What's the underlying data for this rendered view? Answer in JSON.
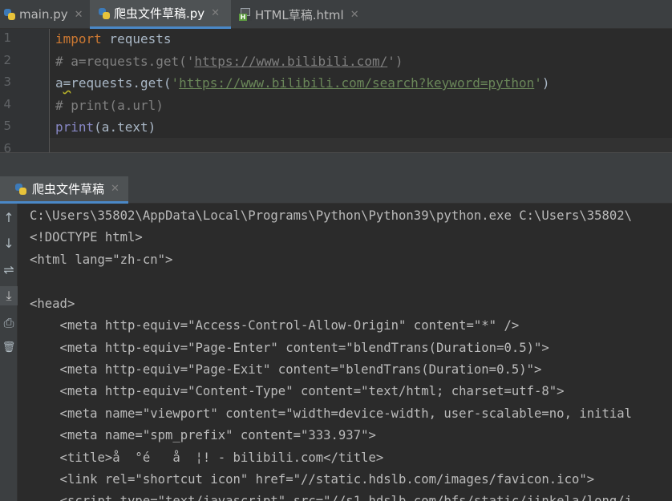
{
  "editor_tabs": [
    {
      "label": "main.py",
      "icon": "python-file-icon",
      "active": false
    },
    {
      "label": "爬虫文件草稿.py",
      "icon": "python-file-icon",
      "active": true
    },
    {
      "label": "HTML草稿.html",
      "icon": "html-file-icon",
      "active": false
    }
  ],
  "close_glyph": "✕",
  "line_numbers": [
    "1",
    "2",
    "3",
    "4",
    "5",
    "6"
  ],
  "code": {
    "l1_kw": "import",
    "l1_rest": " requests",
    "l2_a": "# a=requests.get('",
    "l2_url": "https://www.bilibili.com/",
    "l2_b": "')",
    "l3_a": "a",
    "l3_eq": "=",
    "l3_b": "requests.get(",
    "l3_q1": "'",
    "l3_url": "https://www.bilibili.com/search?keyword=python",
    "l3_q2": "'",
    "l3_c": ")",
    "l4": "# print(a.url)",
    "l5_fn": "print",
    "l5_rest": "(a.text)"
  },
  "run_tab": {
    "label": "爬虫文件草稿",
    "icon": "python-run-icon"
  },
  "toolbar_icons": [
    "arrow-up-icon",
    "arrow-down-icon",
    "soft-wrap-icon",
    "scroll-to-end-icon",
    "print-icon",
    "trash-icon"
  ],
  "toolbar_glyphs": [
    "↑",
    "↓",
    "⇌",
    "⤓",
    "⎙",
    "🗑"
  ],
  "console_lines": [
    "C:\\Users\\35802\\AppData\\Local\\Programs\\Python\\Python39\\python.exe C:\\Users\\35802\\",
    "<!DOCTYPE html>",
    "<html lang=\"zh-cn\">",
    "",
    "<head>",
    "    <meta http-equiv=\"Access-Control-Allow-Origin\" content=\"*\" />",
    "    <meta http-equiv=\"Page-Enter\" content=\"blendTrans(Duration=0.5)\">",
    "    <meta http-equiv=\"Page-Exit\" content=\"blendTrans(Duration=0.5)\">",
    "    <meta http-equiv=\"Content-Type\" content=\"text/html; charset=utf-8\">",
    "    <meta name=\"viewport\" content=\"width=device-width, user-scalable=no, initial",
    "    <meta name=\"spm_prefix\" content=\"333.937\">",
    "    <title>å  °é   å  ¦! - bilibili.com</title>",
    "    <link rel=\"shortcut icon\" href=\"//static.hdslb.com/images/favicon.ico\">",
    "    <script type=\"text/javascript\" src=\"//s1.hdslb.com/bfs/static/jinkela/long/j"
  ],
  "colors": {
    "keyword": "#cc7832",
    "comment": "#808080",
    "string": "#6a8759",
    "builtin": "#8888c6",
    "tab_underline": "#4a88c7"
  }
}
